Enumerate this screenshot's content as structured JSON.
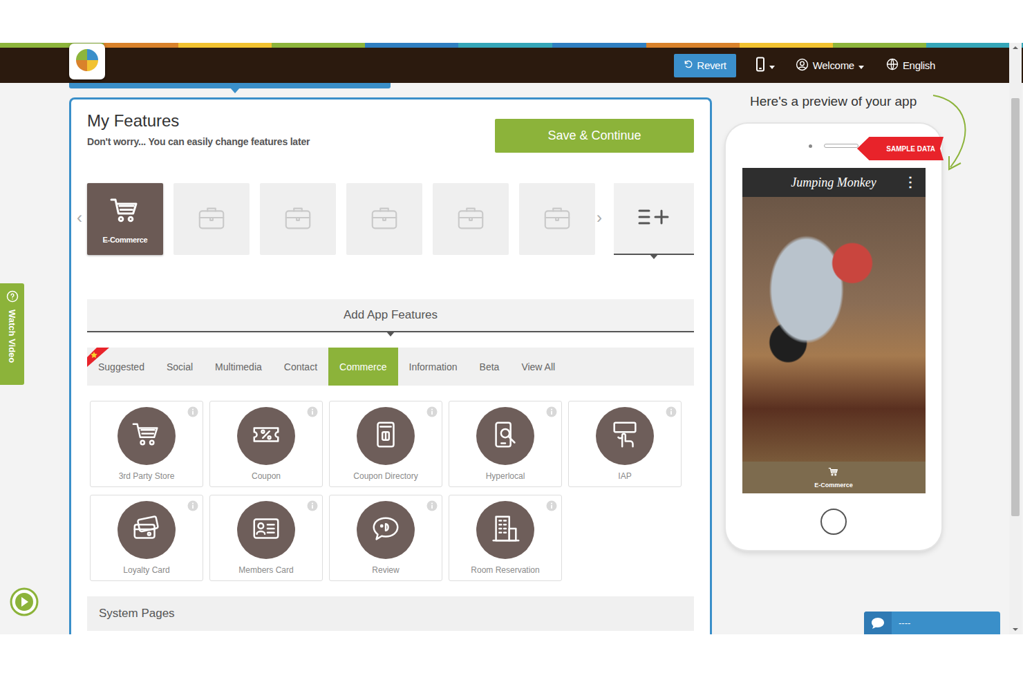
{
  "header": {
    "revert": "Revert",
    "user": "Welcome",
    "language": "English"
  },
  "features": {
    "title": "My Features",
    "subtitle": "Don't worry... You can easily change features later",
    "save_button": "Save & Continue",
    "prev": "‹",
    "next": "›",
    "slots": [
      {
        "label": "E-Commerce",
        "filled": true
      },
      {
        "filled": false
      },
      {
        "filled": false
      },
      {
        "filled": false
      },
      {
        "filled": false
      },
      {
        "filled": false
      }
    ]
  },
  "add_features": {
    "title": "Add App Features",
    "tabs": [
      {
        "label": "Suggested",
        "selected": false
      },
      {
        "label": "Social",
        "selected": false
      },
      {
        "label": "Multimedia",
        "selected": false
      },
      {
        "label": "Contact",
        "selected": false
      },
      {
        "label": "Commerce",
        "selected": true
      },
      {
        "label": "Information",
        "selected": false
      },
      {
        "label": "Beta",
        "selected": false
      },
      {
        "label": "View All",
        "selected": false
      }
    ],
    "items": [
      {
        "label": "3rd Party Store"
      },
      {
        "label": "Coupon"
      },
      {
        "label": "Coupon Directory"
      },
      {
        "label": "Hyperlocal"
      },
      {
        "label": "IAP"
      },
      {
        "label": "Loyalty Card"
      },
      {
        "label": "Members Card"
      },
      {
        "label": "Review"
      },
      {
        "label": "Room Reservation"
      }
    ]
  },
  "system_pages": {
    "title": "System Pages"
  },
  "preview": {
    "heading": "Here's a preview of your app",
    "badge": "SAMPLE DATA",
    "app_title": "Jumping Monkey",
    "menu": "⋮",
    "nav_item": "E-Commerce"
  },
  "side_tab": {
    "label": "Watch Video"
  },
  "chat": {
    "label": "----"
  }
}
